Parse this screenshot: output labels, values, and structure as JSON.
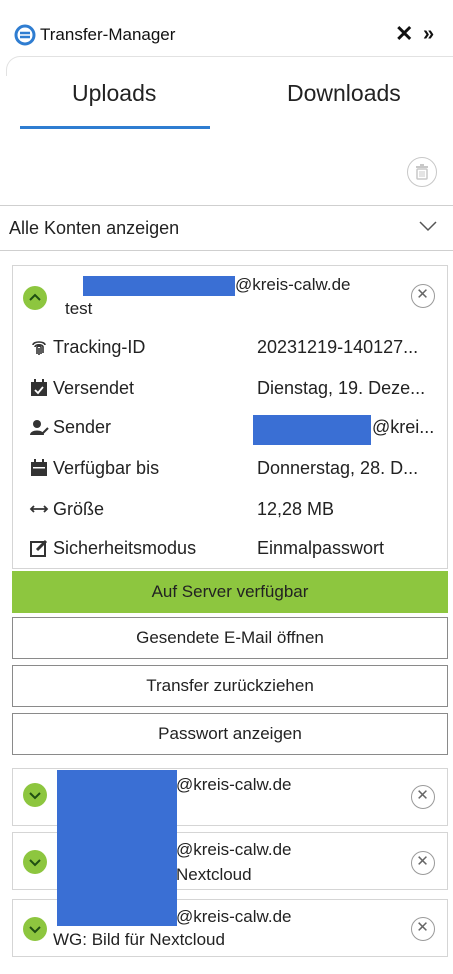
{
  "window": {
    "title": "Transfer-Manager"
  },
  "tabs": [
    {
      "label": "Uploads",
      "active": true
    },
    {
      "label": "Downloads",
      "active": false
    }
  ],
  "filter": {
    "selected": "Alle Konten anzeigen"
  },
  "transfers": [
    {
      "expanded": true,
      "email_suffix": "@kreis-calw.de",
      "subject": "test",
      "details": [
        {
          "icon": "fingerprint-icon",
          "label": "Tracking-ID",
          "value": "20231219-140127..."
        },
        {
          "icon": "calendar-check-icon",
          "label": "Versendet",
          "value": "Dienstag, 19. Deze..."
        },
        {
          "icon": "user-edit-icon",
          "label": "Sender",
          "value": "@krei..."
        },
        {
          "icon": "calendar-icon",
          "label": "Verfügbar bis",
          "value": "Donnerstag, 28. D..."
        },
        {
          "icon": "arrows-horizontal-icon",
          "label": "Größe",
          "value": "12,28 MB"
        },
        {
          "icon": "edit-square-icon",
          "label": "Sicherheitsmodus",
          "value": "Einmalpasswort"
        }
      ],
      "status": "Auf Server verfügbar",
      "actions": [
        "Gesendete E-Mail öffnen",
        "Transfer zurückziehen",
        "Passwort anzeigen"
      ]
    },
    {
      "expanded": false,
      "email_suffix": "@kreis-calw.de",
      "subject": ""
    },
    {
      "expanded": false,
      "email_suffix": "@kreis-calw.de",
      "subject": "Nextcloud"
    },
    {
      "expanded": false,
      "email_suffix": "@kreis-calw.de",
      "subject": "WG: Bild für Nextcloud"
    }
  ],
  "colors": {
    "accent": "#2f7dd1",
    "status_green": "#8dc63f",
    "redaction": "#3a6fd4"
  }
}
